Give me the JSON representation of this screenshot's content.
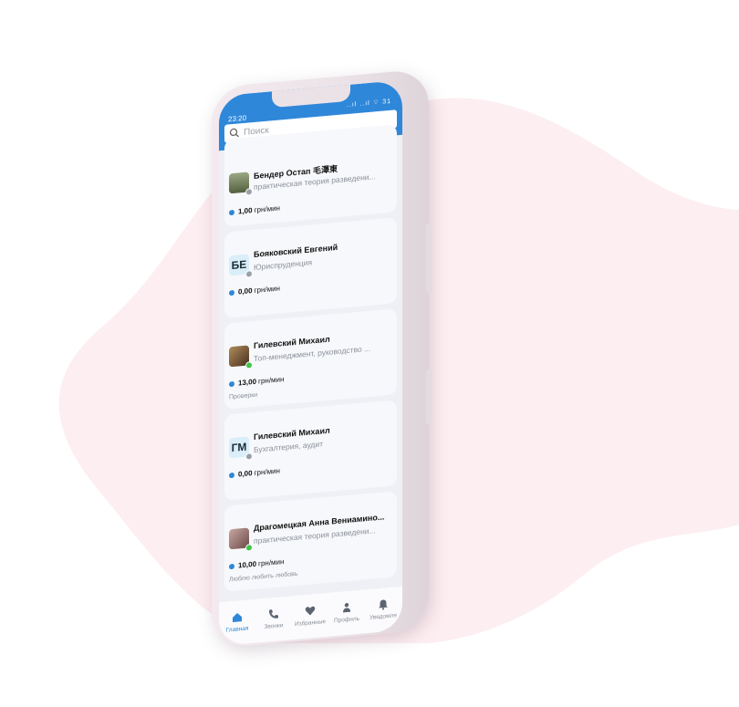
{
  "status": {
    "time": "23:20",
    "indicators": "..ıl ..ıl ⌔ 31"
  },
  "search": {
    "placeholder": "Поиск"
  },
  "cards": [
    {
      "name": "Бендер Остап 毛澤東",
      "spec": "практическая теория разведени...",
      "price_value": "1,00",
      "price_unit": "грн/мин",
      "note": "",
      "avatar": "photo",
      "online": false
    },
    {
      "name": "Бояковский Евгений",
      "spec": "Юриспруденция",
      "price_value": "0,00",
      "price_unit": "грн/мин",
      "note": "",
      "avatar": "БЕ",
      "online": false
    },
    {
      "name": "Гилевский Михаил",
      "spec": "Топ-менеджмент, руководство ...",
      "price_value": "13,00",
      "price_unit": "грн/мин",
      "note": "Проверки",
      "avatar": "photo",
      "online": true
    },
    {
      "name": "Гилевский Михаил",
      "spec": "Бухгалтерия, аудит",
      "price_value": "0,00",
      "price_unit": "грн/мин",
      "note": "",
      "avatar": "ГМ",
      "online": false
    },
    {
      "name": "Драгомецкая Анна Вениамино...",
      "spec": "практическая теория разведени...",
      "price_value": "10,00",
      "price_unit": "грн/мин",
      "note": "Люблю любить любовь",
      "avatar": "photo",
      "online": true
    }
  ],
  "tabs": [
    {
      "label": "Главная",
      "icon": "home-icon",
      "active": true
    },
    {
      "label": "Звонки",
      "icon": "phone-icon",
      "active": false
    },
    {
      "label": "Избранные",
      "icon": "heart-icon",
      "active": false
    },
    {
      "label": "Профиль",
      "icon": "person-icon",
      "active": false
    },
    {
      "label": "Уведомле",
      "icon": "bell-icon",
      "active": false
    }
  ],
  "colors": {
    "accent": "#2f87d9",
    "blob": "#fdeef1",
    "online": "#3cc64a",
    "offline": "#9aa0a8"
  }
}
